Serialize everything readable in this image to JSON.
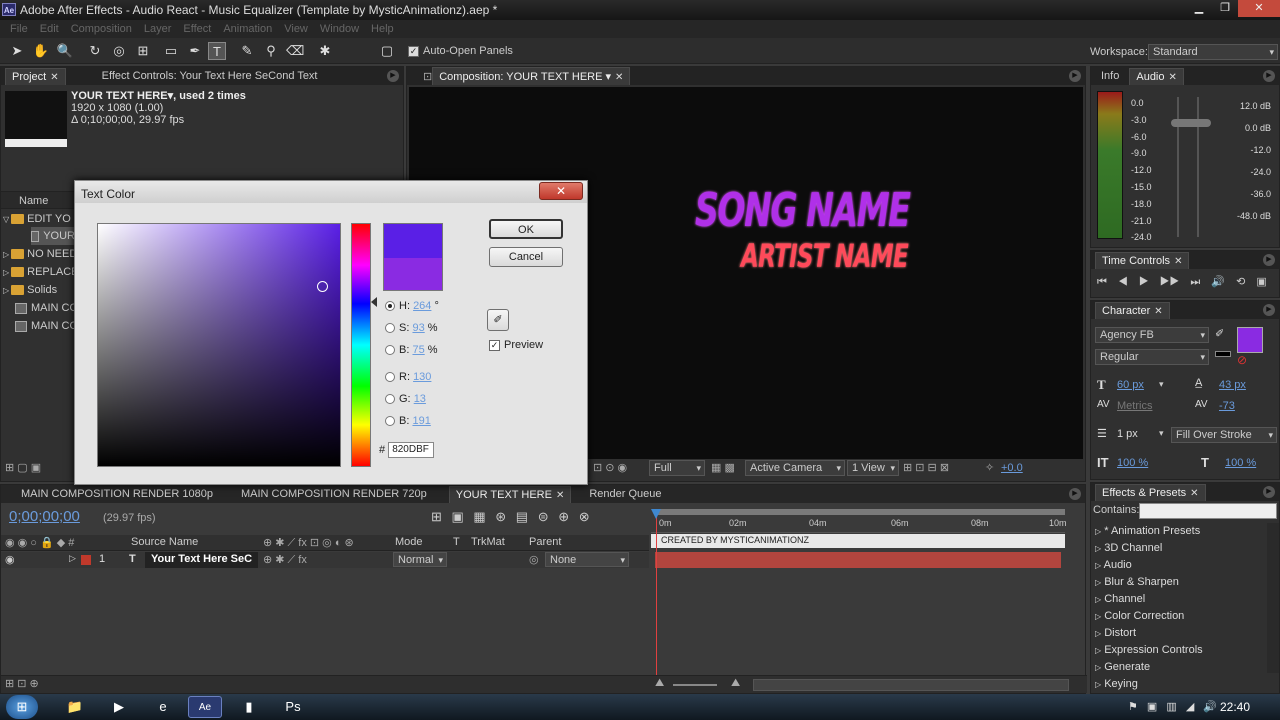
{
  "window": {
    "title": "Adobe After Effects - Audio React - Music Equalizer (Template by MysticAnimationz).aep *",
    "logo": "Ae"
  },
  "menu": [
    "File",
    "Edit",
    "Composition",
    "Layer",
    "Effect",
    "Animation",
    "View",
    "Window",
    "Help"
  ],
  "toolbar": {
    "auto_open_label": "Auto-Open Panels",
    "workspace_label": "Workspace:",
    "workspace_value": "Standard"
  },
  "project": {
    "tab_label": "Project",
    "effect_controls_tab": "Effect Controls: Your Text Here SeCond Text",
    "item_title": "YOUR TEXT HERE▾, used 2 times",
    "item_size": "1920 x 1080 (1.00)",
    "item_duration": "Δ 0;10;00;00, 29.97 fps",
    "column_name": "Name",
    "items": [
      "EDIT YO",
      "YOUR",
      "NO NEED",
      "REPLACE",
      "Solids",
      "MAIN CO",
      "MAIN CO"
    ]
  },
  "composition": {
    "tab_label": "Composition: YOUR TEXT HERE",
    "song_name": "SONG NAME",
    "artist_name": "ARTIST NAME",
    "zoom": "Full",
    "camera": "Active Camera",
    "views": "1 View",
    "exposure": "+0.0"
  },
  "dialog": {
    "title": "Text Color",
    "ok_label": "OK",
    "cancel_label": "Cancel",
    "preview_label": "Preview",
    "h_label": "H:",
    "h_value": "264",
    "h_unit": "°",
    "s_label": "S:",
    "s_value": "93",
    "s_unit": "%",
    "b_label": "B:",
    "b_value": "75",
    "b_unit": "%",
    "r_label": "R:",
    "r_value": "130",
    "g_label": "G:",
    "g_value": "13",
    "bl_label": "B:",
    "bl_value": "191",
    "hex_label": "#",
    "hex_value": "820DBF",
    "new_color": "#5a1fe6",
    "old_color": "#8a2be2"
  },
  "info_audio": {
    "info_tab": "Info",
    "audio_tab": "Audio",
    "db_left": [
      "0.0",
      "-3.0",
      "-6.0",
      "-9.0",
      "-12.0",
      "-15.0",
      "-18.0",
      "-21.0",
      "-24.0"
    ],
    "db_right": [
      "12.0 dB",
      "0.0 dB",
      "-12.0",
      "-24.0",
      "-36.0",
      "-48.0 dB"
    ]
  },
  "time_controls": {
    "tab": "Time Controls"
  },
  "character": {
    "tab": "Character",
    "font": "Agency FB",
    "style": "Regular",
    "font_size": "60 px",
    "leading": "43 px",
    "kerning": "Metrics",
    "tracking": "-73",
    "stroke_width": "1 px",
    "stroke_type": "Fill Over Stroke",
    "vscale": "100 %",
    "hscale": "100 %",
    "fill_color": "#8a2be2"
  },
  "effects": {
    "tab": "Effects & Presets",
    "contains_label": "Contains:",
    "items": [
      "* Animation Presets",
      "3D Channel",
      "Audio",
      "Blur & Sharpen",
      "Channel",
      "Color Correction",
      "Distort",
      "Expression Controls",
      "Generate",
      "Keying"
    ]
  },
  "timeline": {
    "tabs": [
      "MAIN COMPOSITION RENDER 1080p",
      "MAIN COMPOSITION RENDER 720p",
      "YOUR TEXT HERE",
      "Render Queue"
    ],
    "timecode": "0;00;00;00",
    "fps": "(29.97 fps)",
    "col_source": "Source Name",
    "col_mode": "Mode",
    "col_t": "T",
    "col_trkmat": "TrkMat",
    "col_parent": "Parent",
    "layer_num": "1",
    "layer_type": "T",
    "layer_name": "Your Text Here SeC",
    "layer_mode": "Normal",
    "layer_parent": "None",
    "ruler": [
      "0m",
      "02m",
      "04m",
      "06m",
      "08m",
      "10m"
    ],
    "marker_label": "CREATED BY MYSTICANIMATIONZ"
  },
  "taskbar": {
    "clock": "22:40"
  }
}
